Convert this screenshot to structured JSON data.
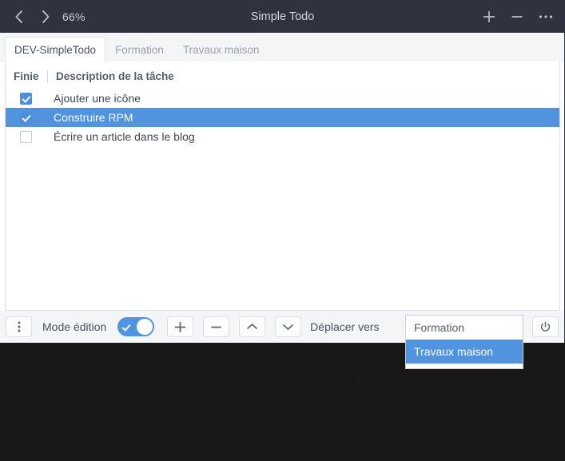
{
  "titlebar": {
    "back_icon": "chevron-left-icon",
    "forward_icon": "chevron-right-icon",
    "zoom_level": "66%",
    "title": "Simple Todo",
    "plus_label": "+",
    "minus_label": "−",
    "more_label": "⋯",
    "background": "#2e333f",
    "text_color": "#c3c7d1"
  },
  "tabs": [
    {
      "label": "DEV-SimpleTodo",
      "active": true
    },
    {
      "label": "Formation",
      "active": false
    },
    {
      "label": "Travaux maison",
      "active": false
    }
  ],
  "table": {
    "headers": {
      "done": "Finie",
      "description": "Description de la tâche"
    },
    "rows": [
      {
        "checked": true,
        "description": "Ajouter une icône",
        "selected": false
      },
      {
        "checked": true,
        "description": "Construire RPM",
        "selected": true
      },
      {
        "checked": false,
        "description": "Écrire un article dans le blog",
        "selected": false
      }
    ]
  },
  "toolbar": {
    "overflow_icon": "kebab-menu-icon",
    "edit_mode_label": "Mode édition",
    "edit_mode_on": true,
    "add_label": "+",
    "remove_label": "−",
    "move_up_icon": "chevron-up-icon",
    "move_down_icon": "chevron-down-icon",
    "move_to_label": "Déplacer vers",
    "power_icon": "power-icon"
  },
  "dropdown": {
    "options": [
      {
        "label": "Formation",
        "selected": false
      },
      {
        "label": "Travaux maison",
        "selected": true
      }
    ]
  },
  "colors": {
    "accent": "#5093de",
    "checkbox_accent": "#4a90e2",
    "titlebar_bg": "#2e333f",
    "panel_bg": "#f4f5f7",
    "content_bg": "#ffffff",
    "border": "#dfe2e8",
    "text_primary": "#4a5160",
    "text_muted": "#9aa0ab",
    "desktop_bg": "#181818"
  }
}
